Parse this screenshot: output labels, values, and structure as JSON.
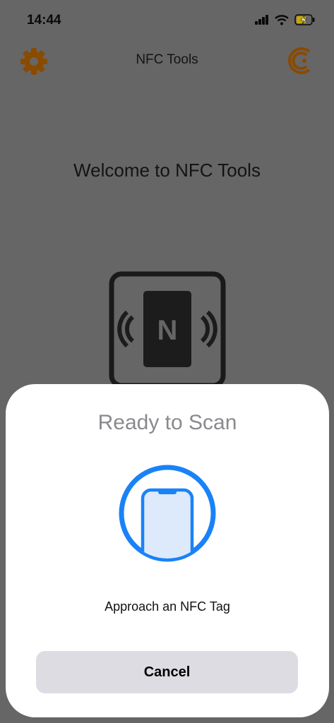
{
  "status_bar": {
    "time": "14:44",
    "icons": [
      "signal-icon",
      "wifi-icon",
      "battery-charging-icon"
    ]
  },
  "nav": {
    "title": "NFC Tools",
    "left_icon": "settings-gear-icon",
    "right_icon": "account-icon"
  },
  "main": {
    "welcome": "Welcome to NFC Tools",
    "graphic_letter": "N"
  },
  "scan_sheet": {
    "title": "Ready to Scan",
    "message": "Approach an NFC Tag",
    "cancel_label": "Cancel"
  },
  "colors": {
    "background_dimmed": "#666666",
    "accent_orange": "#8a4a00",
    "scan_blue": "#1a82f7",
    "cancel_bg": "#dcdce2"
  }
}
